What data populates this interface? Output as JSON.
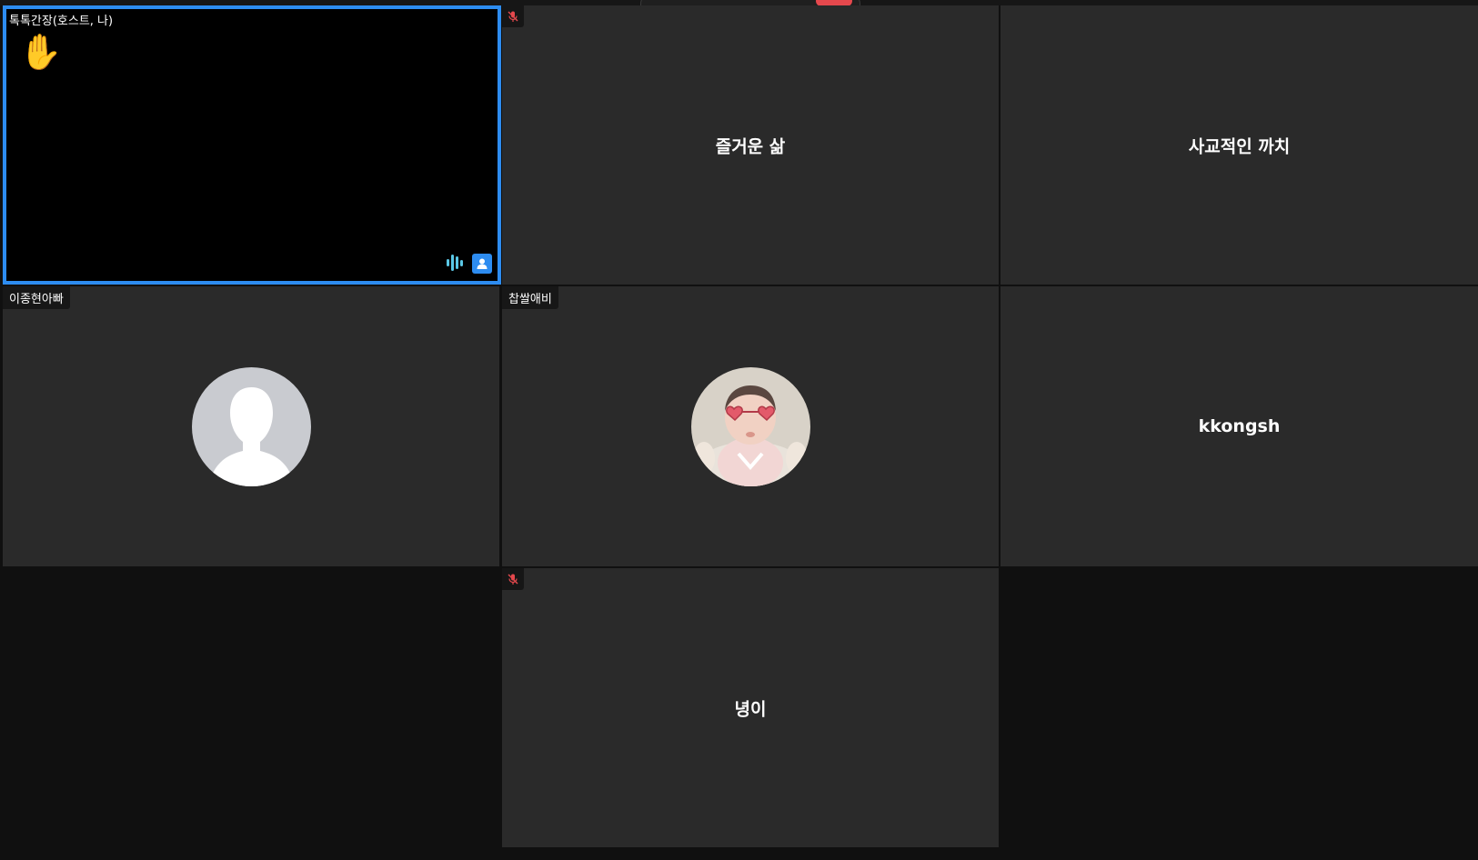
{
  "participants": {
    "host": {
      "name": "톡톡간장(호스트, 나)",
      "reaction": "✋"
    },
    "p1": {
      "name": "즐거운 삶"
    },
    "p2": {
      "name": "사교적인 까치"
    },
    "p3": {
      "name": "이종현아빠"
    },
    "p4": {
      "name": "찹쌀애비"
    },
    "p5": {
      "name": "kkongsh"
    },
    "p6": {
      "name": "녕이"
    }
  },
  "colors": {
    "active_speaker_border": "#2d8cf0",
    "tile_bg": "#2a2a2a",
    "mute_red": "#e5484d",
    "audio_bars": "#5bc8e6"
  },
  "icons": {
    "mute": "mic-off-icon",
    "audio": "audio-wave-icon",
    "profile": "user-profile-icon"
  }
}
